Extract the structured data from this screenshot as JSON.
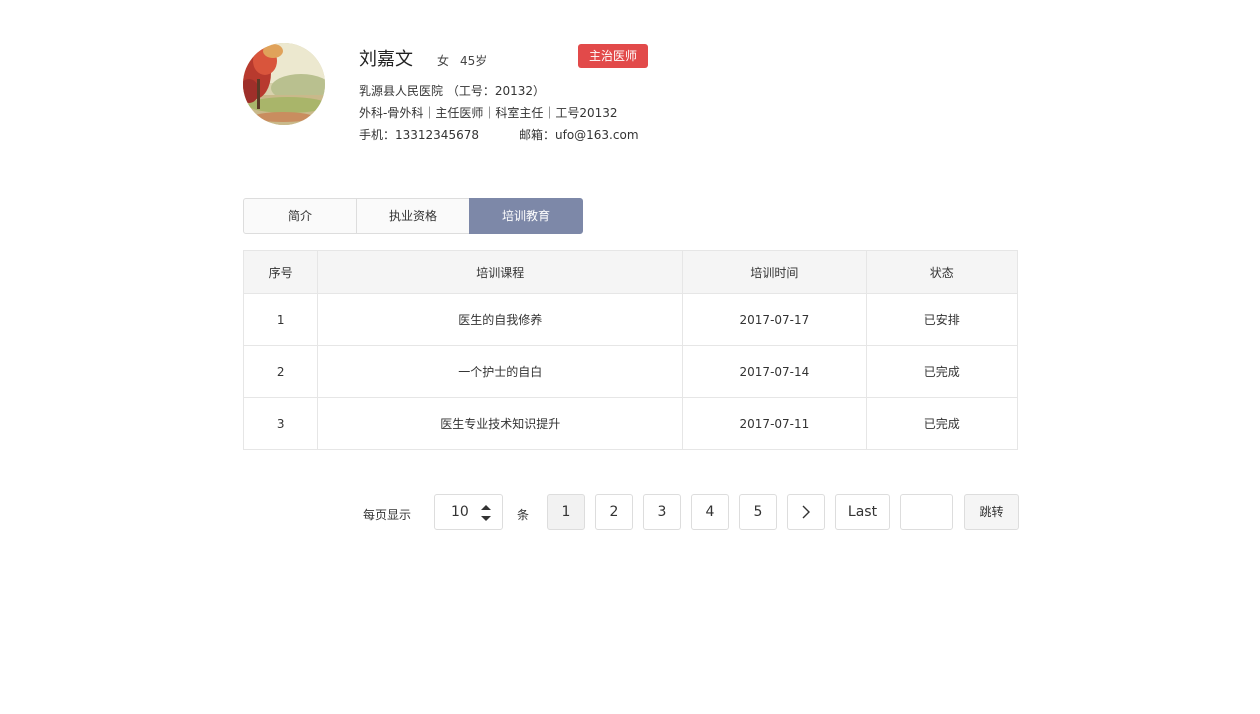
{
  "profile": {
    "name": "刘嘉文",
    "gender": "女",
    "age": "45岁",
    "title_badge": "主治医师",
    "hospital_line": "乳源县人民医院 （工号：20132）",
    "dept_line": "外科-骨外科｜主任医师｜科室主任｜工号20132",
    "phone": "手机：13312345678",
    "email": "邮箱：ufo@163.com",
    "badge_color": "#e24a4a"
  },
  "tabs": [
    {
      "label": "简介"
    },
    {
      "label": "执业资格"
    },
    {
      "label": "培训教育",
      "active": true
    }
  ],
  "table": {
    "headers": [
      "序号",
      "培训课程",
      "培训时间",
      "状态"
    ],
    "rows": [
      [
        "1",
        "医生的自我修养",
        "2017-07-17",
        "已安排"
      ],
      [
        "2",
        "一个护士的自白",
        "2017-07-14",
        "已完成"
      ],
      [
        "3",
        "医生专业技术知识提升",
        "2017-07-11",
        "已完成"
      ]
    ]
  },
  "pagination": {
    "per_page_label": "每页显示",
    "per_page_value": "10",
    "unit_label": "条",
    "pages": [
      "1",
      "2",
      "3",
      "4",
      "5"
    ],
    "current_page": "1",
    "next_icon": "chevron-right-icon",
    "last_label": "Last",
    "jump_input_value": "",
    "jump_button": "跳转"
  },
  "colors": {
    "active_tab": "#7d88a8",
    "header_bg": "#f5f5f5"
  }
}
